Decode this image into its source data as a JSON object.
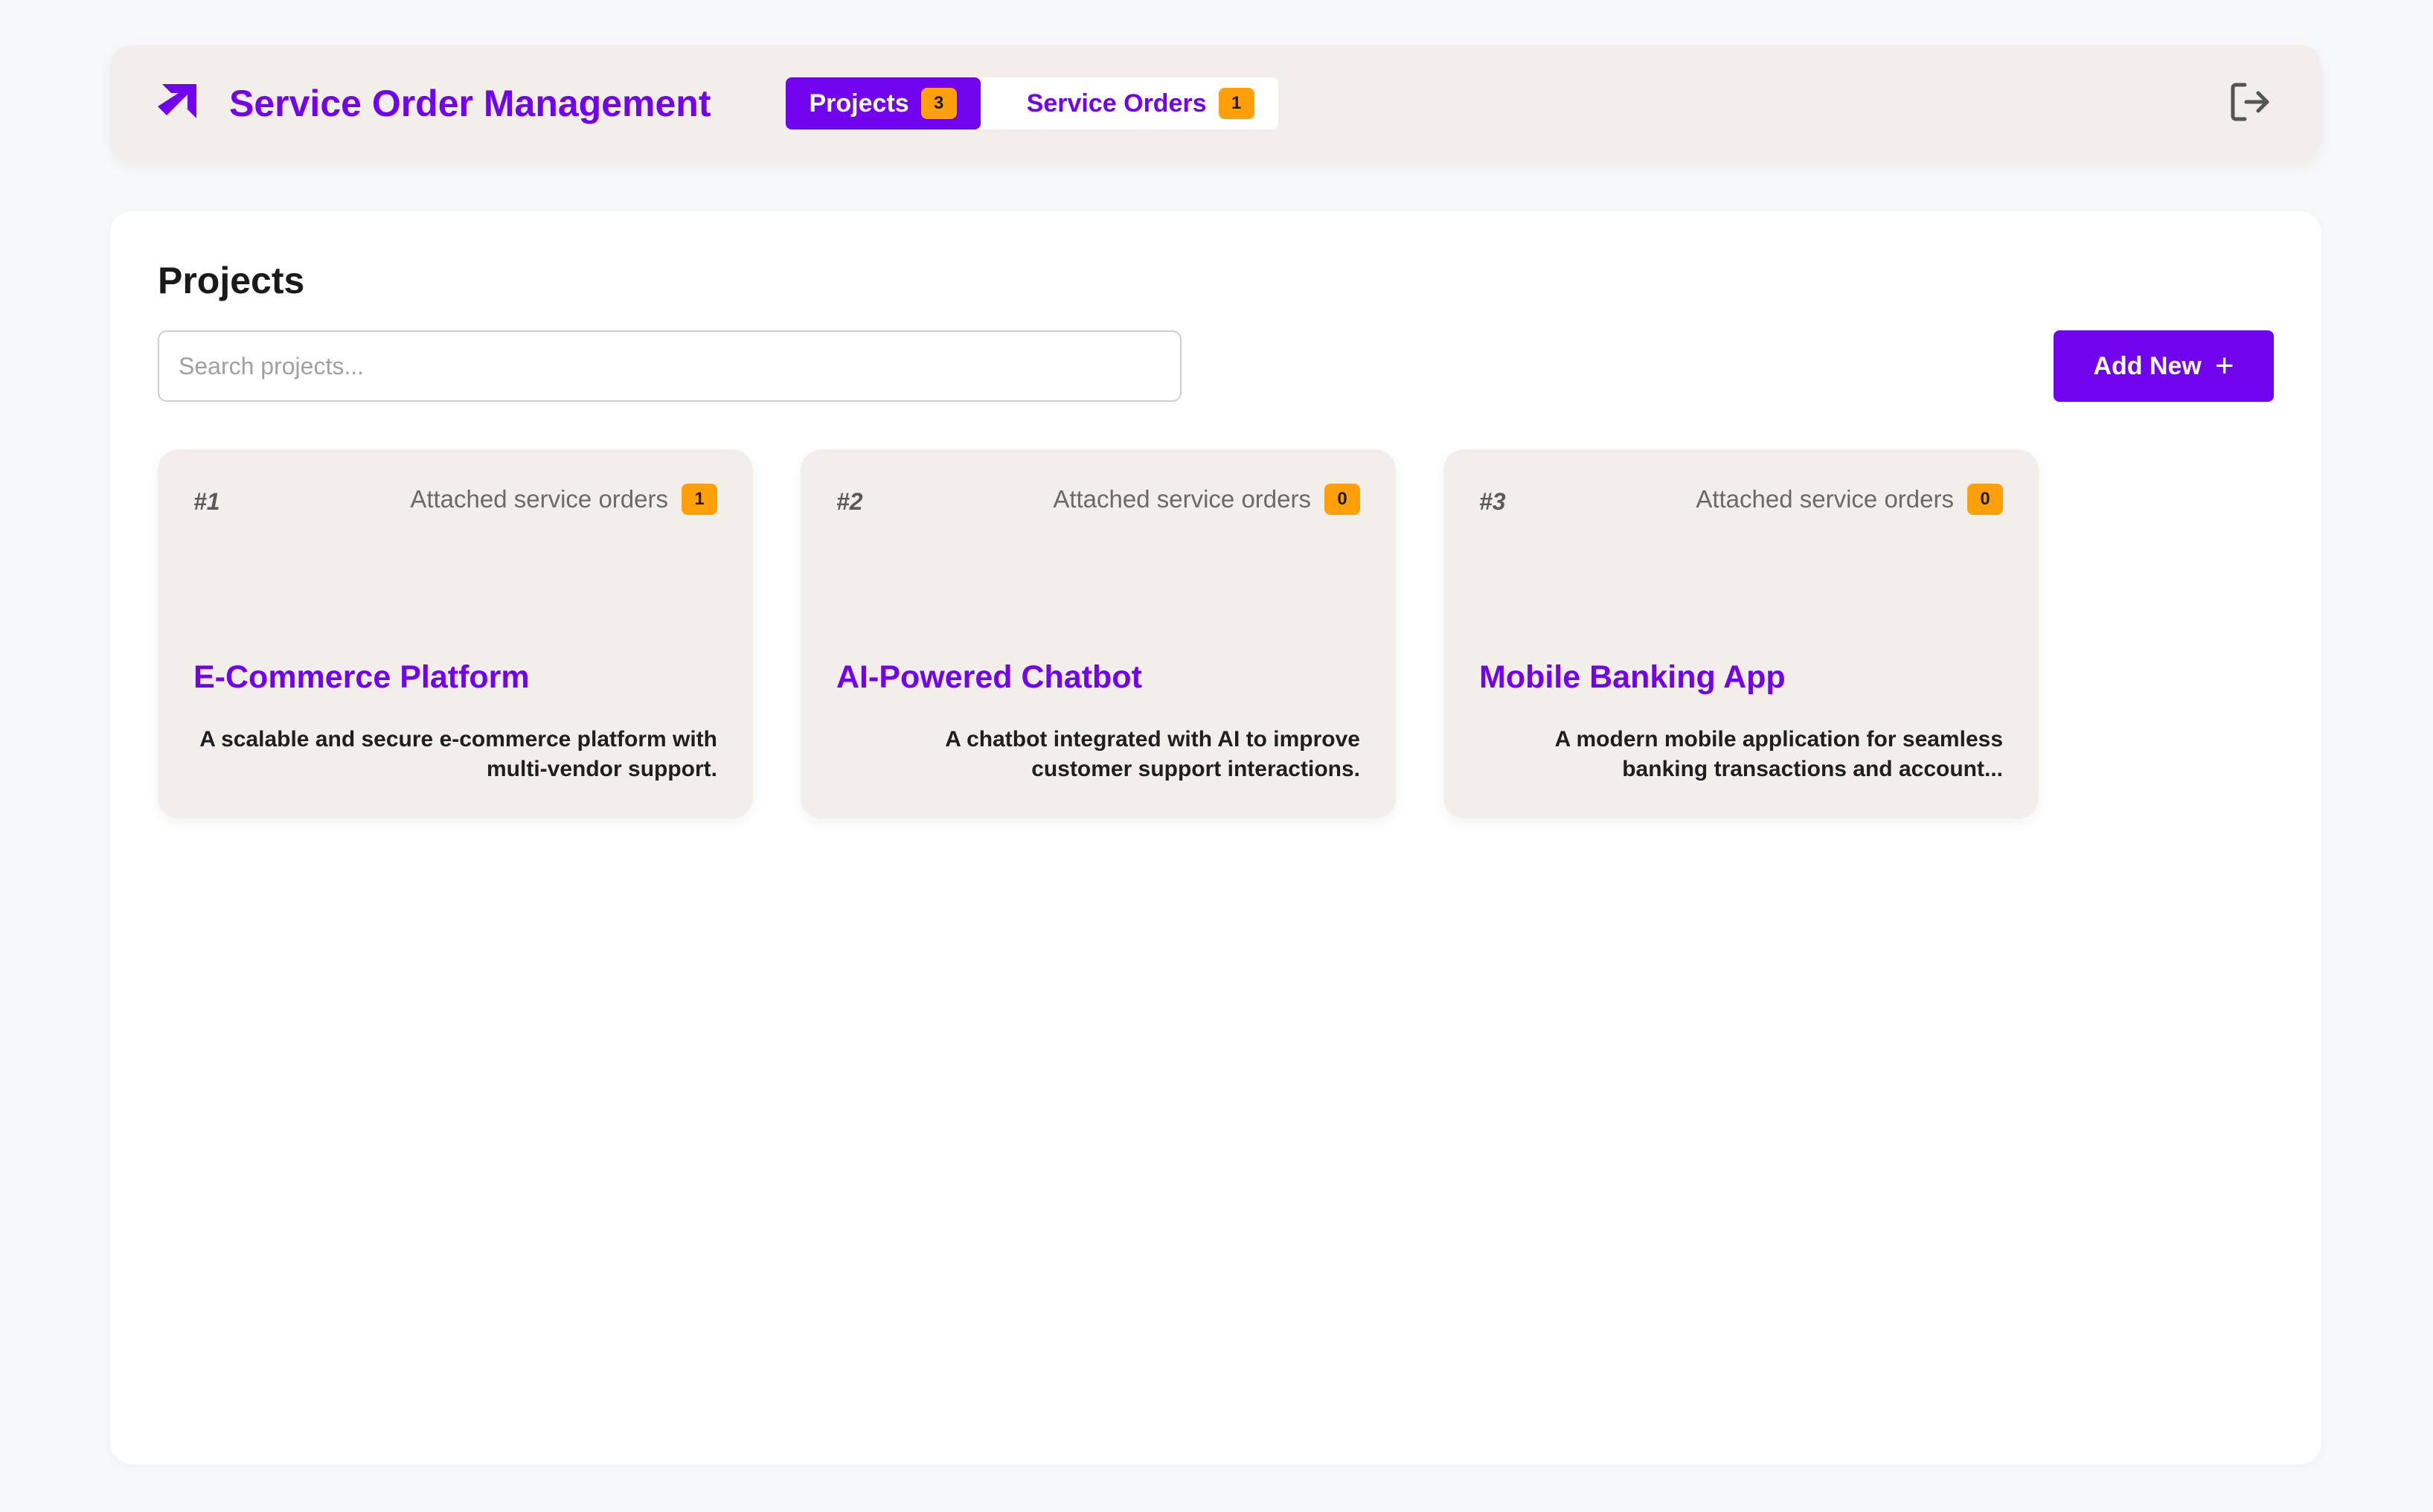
{
  "app": {
    "title": "Service Order Management",
    "accent_color": "#7103ee",
    "badge_color": "#ff9f0a"
  },
  "header": {
    "logo_icon": "arrow-up-right-icon",
    "nav_tabs": [
      {
        "label": "Projects",
        "count": "3",
        "active": true
      },
      {
        "label": "Service Orders",
        "count": "1",
        "active": false
      }
    ],
    "logout_icon": "logout-icon"
  },
  "main": {
    "title": "Projects",
    "search": {
      "placeholder": "Search projects...",
      "value": ""
    },
    "add_button_label": "Add New",
    "add_button_icon": "plus-icon"
  },
  "projects": [
    {
      "number": "#1",
      "orders_label": "Attached service orders",
      "orders_count": "1",
      "title": "E-Commerce Platform",
      "description": "A scalable and secure e-commerce platform with multi-vendor support."
    },
    {
      "number": "#2",
      "orders_label": "Attached service orders",
      "orders_count": "0",
      "title": "AI-Powered Chatbot",
      "description": "A chatbot integrated with AI to improve customer support interactions."
    },
    {
      "number": "#3",
      "orders_label": "Attached service orders",
      "orders_count": "0",
      "title": "Mobile Banking App",
      "description": "A modern mobile application for seamless banking transactions and account..."
    }
  ]
}
